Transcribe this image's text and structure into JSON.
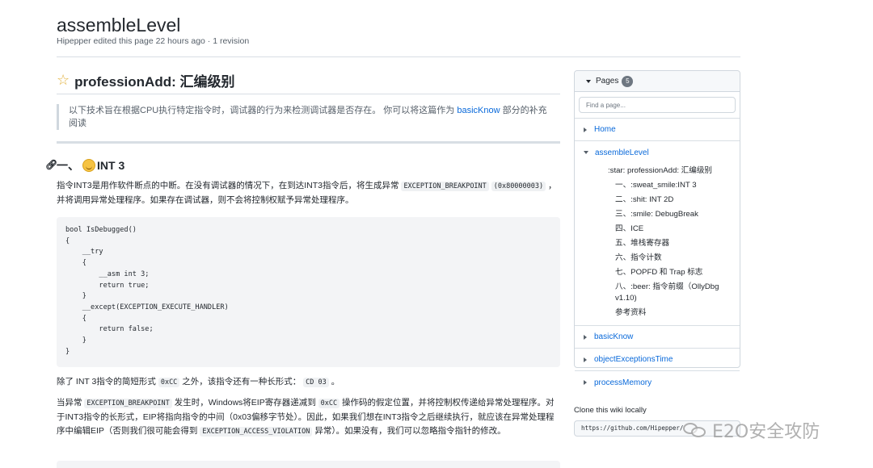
{
  "page": {
    "title": "assembleLevel",
    "meta": "Hipepper edited this page 22 hours ago · 1 revision"
  },
  "content": {
    "h2": "professionAdd: 汇编级别",
    "quote_pre": "以下技术旨在根据CPU执行特定指令时，调试器的行为来检测调试器是否存在。 你可以将这篇作为 ",
    "quote_link": "basicKnow",
    "quote_post": " 部分的补充阅读",
    "h3_prefix": "一、",
    "h3_suffix": "INT 3",
    "p1_a": "指令INT3是用作软件断点的中断。在没有调试器的情况下，在到达INT3指令后，将生成异常 ",
    "p1_code1": "EXCEPTION_BREAKPOINT",
    "p1_code2": "(0x80000003)",
    "p1_b": " ，并将调用异常处理程序。如果存在调试器，则不会将控制权赋予异常处理程序。",
    "code": "bool IsDebugged()\n{\n    __try\n    {\n        __asm int 3;\n        return true;\n    }\n    __except(EXCEPTION_EXECUTE_HANDLER)\n    {\n        return false;\n    }\n}",
    "p2_a": "除了 INT 3指令的简短形式 ",
    "p2_code1": "0xCC",
    "p2_b": " 之外，该指令还有一种长形式： ",
    "p2_code2": "CD 03",
    "p2_c": " 。",
    "p3_a": "当异常 ",
    "p3_code1": "EXCEPTION_BREAKPOINT",
    "p3_b": " 发生时，Windows将EIP寄存器递减到 ",
    "p3_code2": "0xCC",
    "p3_c": " 操作码的假定位置，并将控制权传递给异常处理程序。对于INT3指令的长形式，EIP将指向指令的中间（0x03偏移字节处）。因此，如果我们想在INT3指令之后继续执行，就应该在异常处理程序中编辑EIP（否则我们很可能会得到 ",
    "p3_code3": "EXCEPTION_ACCESS_VIOLATION",
    "p3_d": " 异常）。如果没有，我们可以忽略指令指针的修改。"
  },
  "sidebar": {
    "header": "Pages",
    "count": "5",
    "search_placeholder": "Find a page...",
    "pages": [
      {
        "label": "Home"
      },
      {
        "label": "assembleLevel"
      },
      {
        "label": "basicKnow"
      },
      {
        "label": "objectExceptionsTime"
      },
      {
        "label": "processMemory"
      }
    ],
    "toc": [
      ":star: professionAdd: 汇编级别",
      "一、:sweat_smile:INT 3",
      "二、:shit: INT 2D",
      "三、:smile: DebugBreak",
      "四、ICE",
      "五、堆栈寄存器",
      "六、指令计数",
      "七、POPFD 和 Trap 标志",
      "八、:beer: 指令前缀（OllyDbg v1.10)",
      "参考资料"
    ],
    "clone_title": "Clone this wiki locally",
    "clone_url": "https://github.com/Hipepper/"
  },
  "watermark": "E2O安全攻防",
  "icons": [
    "star-icon",
    "link-icon",
    "sweat-smile-icon",
    "caret-down-icon",
    "caret-right-icon",
    "wechat-icon"
  ]
}
